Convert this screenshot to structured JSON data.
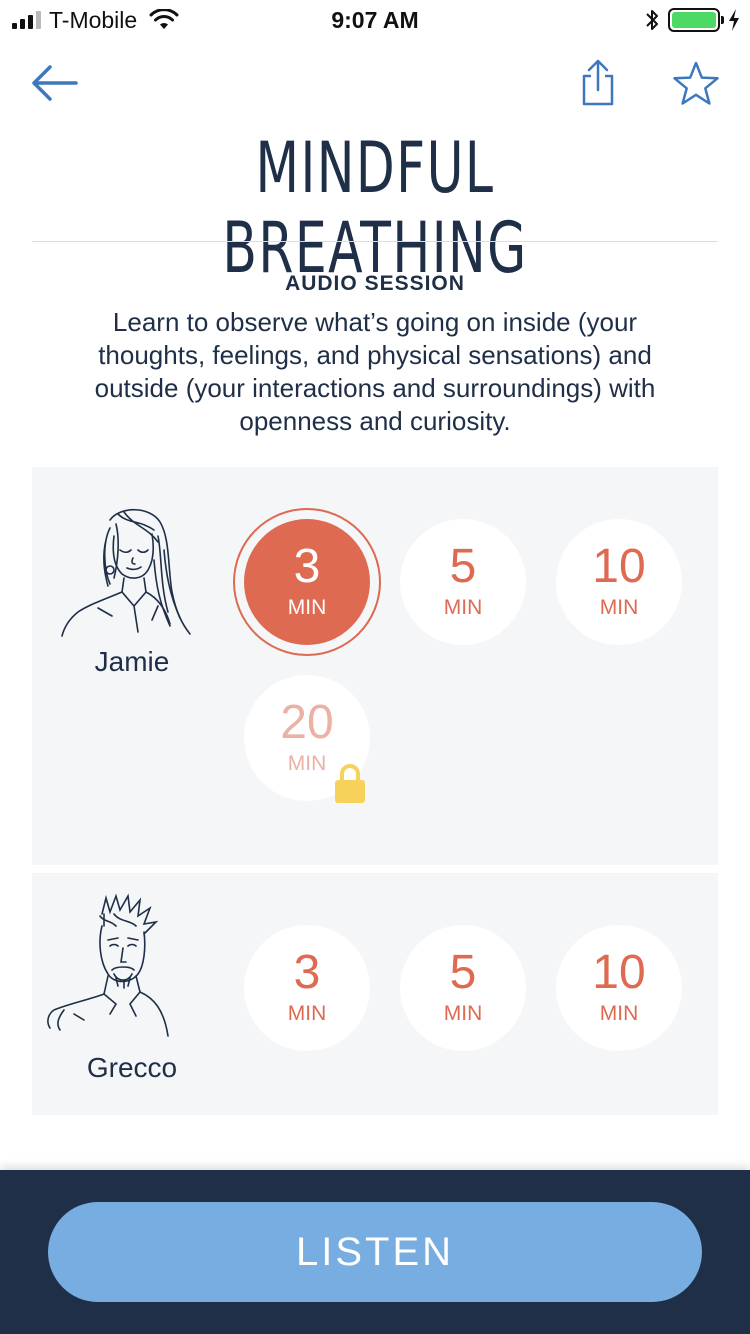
{
  "status_bar": {
    "carrier": "T-Mobile",
    "time": "9:07 AM",
    "battery_level": 1.0
  },
  "header": {
    "title": "MINDFUL BREATHING",
    "icons": {
      "back": "arrow-left-icon",
      "share": "share-icon",
      "favorite": "star-icon"
    }
  },
  "session": {
    "type_label": "AUDIO SESSION",
    "description": "Learn to observe what’s going on inside (your thoughts, feelings, and physical sensations) and outside (your interactions and surroundings) with openness and curiosity."
  },
  "narrators": [
    {
      "name": "Jamie",
      "durations": [
        {
          "value": "3",
          "unit": "MIN",
          "state": "selected"
        },
        {
          "value": "5",
          "unit": "MIN",
          "state": "default"
        },
        {
          "value": "10",
          "unit": "MIN",
          "state": "default"
        },
        {
          "value": "20",
          "unit": "MIN",
          "state": "locked"
        }
      ]
    },
    {
      "name": "Grecco",
      "durations": [
        {
          "value": "3",
          "unit": "MIN",
          "state": "default"
        },
        {
          "value": "5",
          "unit": "MIN",
          "state": "default"
        },
        {
          "value": "10",
          "unit": "MIN",
          "state": "default"
        }
      ]
    }
  ],
  "footer": {
    "listen_label": "LISTEN"
  },
  "colors": {
    "accent": "#de6a52",
    "accent_locked": "#eab1a4",
    "navy": "#1f2f47",
    "link_blue": "#3d78bd",
    "listen_blue": "#78ade1",
    "card_bg": "#f4f6f8",
    "lock_yellow": "#f7d25a"
  }
}
